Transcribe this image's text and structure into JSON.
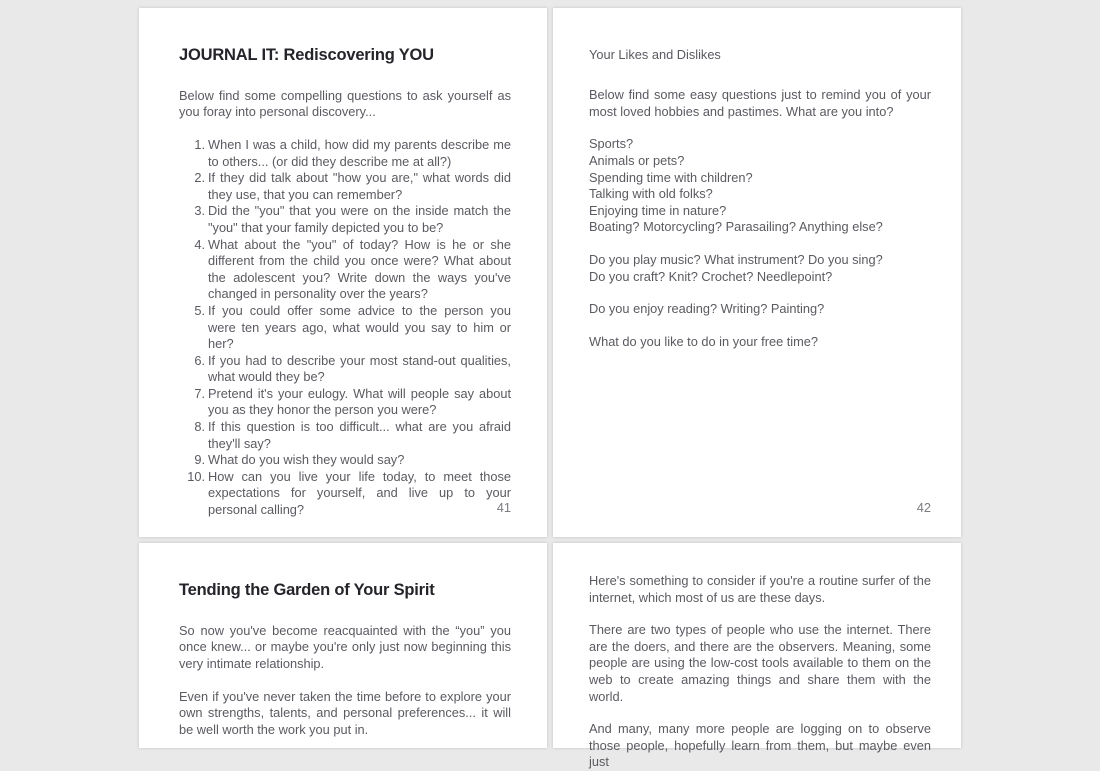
{
  "viewer": {
    "background_color": "#e9e9e9",
    "page_background_color": "#ffffff",
    "heading_color": "#24242a",
    "body_color": "#5a5a61",
    "page_number_color": "#7b7b82"
  },
  "pages": [
    {
      "number": "41",
      "title": "JOURNAL IT: Rediscovering YOU",
      "intro": "Below find some compelling questions to ask yourself as you foray into personal discovery...",
      "questions": [
        "When I was a child, how did my parents describe me to others... (or did they describe me at all?)",
        "If they did talk about \"how you are,\" what words did they use, that you can remember?",
        "Did the \"you\" that you were on the inside match the \"you\" that your family depicted you to be?",
        "What about the \"you\" of today? How is he or she different from the child you once were? What about the adolescent you? Write down the ways you've changed in personality over the years?",
        "If you could offer some advice to the person you were ten years ago, what would you say to him or her?",
        "If you had to describe your most stand-out qualities, what would they be?",
        "Pretend it's your eulogy. What will people say about you as they honor the person you were?",
        "If this question is too difficult... what are you afraid they'll say?",
        "What do you wish they would say?",
        "How can you live your life today, to meet those expectations for yourself, and live up to your personal calling?"
      ]
    },
    {
      "number": "42",
      "title": "Your Likes and Dislikes",
      "intro": "Below find some easy questions just to remind you of your most loved hobbies and pastimes. What are you into?",
      "groups": [
        [
          "Sports?",
          "Animals or pets?",
          "Spending time with children?",
          "Talking with old folks?",
          "Enjoying time in nature?",
          "Boating? Motorcycling? Parasailing? Anything else?"
        ],
        [
          "Do you play music? What instrument? Do you sing?",
          "Do you craft? Knit? Crochet? Needlepoint?"
        ],
        [
          "Do you enjoy reading? Writing? Painting?"
        ],
        [
          "What do you like to do in your free time?"
        ]
      ]
    },
    {
      "title": "Tending the Garden of Your Spirit",
      "paragraphs": [
        "So now you've become reacquainted with the “you” you once knew... or maybe you're only just now beginning this very intimate relationship.",
        "Even if you've never taken the time before to explore your own strengths, talents, and personal preferences... it will be well worth the work you put in."
      ]
    },
    {
      "paragraphs": [
        "Here's something to consider if you're a routine surfer of the internet, which most of us are these days.",
        "There are two types of people who use the internet. There are the doers, and there are the observers. Meaning, some people are using the low-cost tools available to them on the web to create amazing things and share them with the world.",
        "And many, many more people are logging on to observe those people, hopefully learn from them, but maybe even just"
      ]
    }
  ]
}
